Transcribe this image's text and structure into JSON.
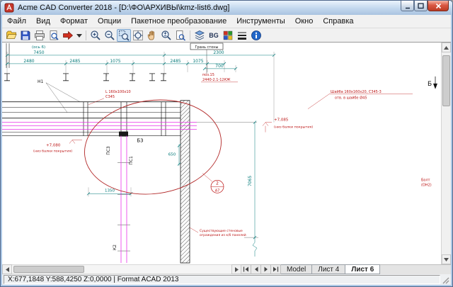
{
  "window": {
    "title": "Acme CAD Converter 2018 - [D:\\ФО\\АРХИВЫ\\kmz-list6.dwg]"
  },
  "menu": {
    "items": [
      "Файл",
      "Вид",
      "Формат",
      "Опции",
      "Пакетное преобразование",
      "Инструменты",
      "Окно",
      "Справка"
    ]
  },
  "toolbar": {
    "bg_label": "BG",
    "active_tool": "zoom-window",
    "icons": [
      "open-icon",
      "save-icon",
      "print-icon",
      "print-preview-icon",
      "convert-icon",
      "convert-dropdown-icon",
      "zoom-in-icon",
      "zoom-out-icon",
      "zoom-window-icon",
      "zoom-extents-icon",
      "pan-icon",
      "zoom-realtime-icon",
      "zoom-page-icon",
      "layers-icon",
      "bg-toggle",
      "palette-icon",
      "linewidth-icon",
      "info-icon"
    ]
  },
  "drawing": {
    "colors": {
      "dimension": "#007878",
      "annotation": "#bb1111",
      "axis_line": "#e832e8",
      "ellipse": "#b22828"
    },
    "labels": {
      "axis6": "(ось 6)",
      "dim_7450": "7450",
      "dim_2480": "2480",
      "dim_2485a": "2485",
      "dim_1075a": "1075",
      "dim_2300": "2300",
      "dim_2485b": "2485",
      "dim_1075b": "1075",
      "dim_700": "700",
      "dim_650": "650",
      "dim_1350": "1350",
      "dim_7065": "7065",
      "gran_label": "Грань стены",
      "n1": "Н1",
      "poz15_line1": "поз.15",
      "poz15_line2": "2440-2.1-12КЖ",
      "angle_line1": "L 160х100х10",
      "angle_line2": "С345",
      "shayba_line1": "Шайба 160х160х20, С345-3",
      "shayba_line2": "отв. в шайбе Ø45",
      "elev_left_value": "+7,080",
      "elev_left_note": "(низ балки покрытия)",
      "elev_right_value": "+7,085",
      "elev_right_note": "(низ балки покрытия)",
      "b3": "Б3",
      "ps3": "ПС3",
      "ps1": "ПС1",
      "k2": "К2",
      "callout_number": "2",
      "callout_sheet": "А7",
      "wall_note_line1": "Существующие стеновые",
      "wall_note_line2": "ограждения из к/б панелей",
      "bolt_line1": "Болт",
      "bolt_line2": "(ОН2)",
      "section_mark": "Б"
    }
  },
  "sheet_tabs": {
    "items": [
      {
        "label": "Model",
        "active": false
      },
      {
        "label": "Лист 4",
        "active": false
      },
      {
        "label": "Лист 6",
        "active": true
      }
    ]
  },
  "statusbar": {
    "text": "X:677,1848 Y:588,4250 Z:0,0000 | Format ACAD 2013"
  }
}
